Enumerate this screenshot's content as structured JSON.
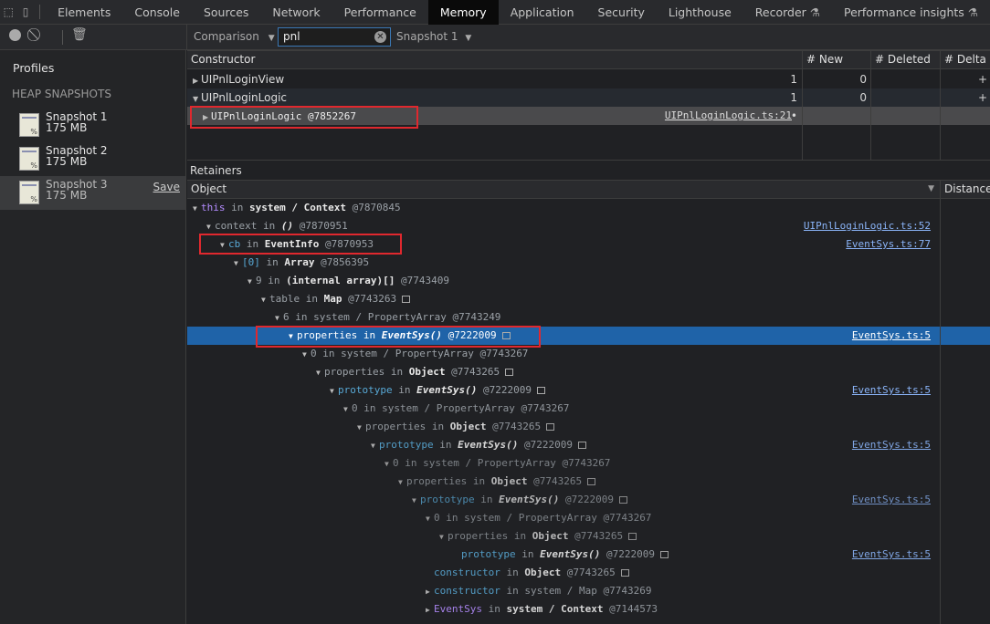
{
  "tabs": [
    {
      "label": "Elements"
    },
    {
      "label": "Console"
    },
    {
      "label": "Sources"
    },
    {
      "label": "Network"
    },
    {
      "label": "Performance"
    },
    {
      "label": "Memory",
      "active": true
    },
    {
      "label": "Application"
    },
    {
      "label": "Security"
    },
    {
      "label": "Lighthouse"
    },
    {
      "label": "Recorder",
      "experimental": true
    },
    {
      "label": "Performance insights",
      "experimental": true
    }
  ],
  "toolbar": {
    "view_select": "Comparison",
    "filter_value": "pnl",
    "baseline_select": "Snapshot 1"
  },
  "sidebar": {
    "title": "Profiles",
    "section": "HEAP SNAPSHOTS",
    "snapshots": [
      {
        "name": "Snapshot 1",
        "size": "175 MB"
      },
      {
        "name": "Snapshot 2",
        "size": "175 MB"
      },
      {
        "name": "Snapshot 3",
        "size": "175 MB",
        "selected": true,
        "save_label": "Save"
      }
    ]
  },
  "comparison": {
    "columns": [
      "Constructor",
      "# New",
      "# Deleted",
      "# Delta"
    ],
    "rows": [
      {
        "name": "UIPnlLoginView",
        "expanded": false,
        "new": "1",
        "deleted": "0",
        "delta": "+"
      },
      {
        "name": "UIPnlLoginLogic",
        "expanded": true,
        "new": "1",
        "deleted": "0",
        "delta": "+"
      },
      {
        "name": "UIPnlLoginLogic @7852267",
        "child": true,
        "link": "UIPnlLoginLogic.ts:21",
        "new": "•"
      }
    ]
  },
  "retainers": {
    "title": "Retainers",
    "columns": [
      "Object",
      "Distance"
    ],
    "rows": [
      {
        "d": 0,
        "a": "▼",
        "prop": "this",
        "pc": "pp",
        "cls": "system / Context",
        "ci": false,
        "id": "@7870845"
      },
      {
        "d": 1,
        "a": "▼",
        "prop": "context",
        "pc": "pn",
        "cls": "()",
        "ci": true,
        "id": "@7870951",
        "link": "UIPnlLoginLogic.ts:52"
      },
      {
        "d": 2,
        "a": "▼",
        "prop": "cb",
        "pc": "pc",
        "cls": "EventInfo",
        "id": "@7870953",
        "link": "EventSys.ts:77"
      },
      {
        "d": 3,
        "a": "▼",
        "prop": "[0]",
        "pc": "pc",
        "cls": "Array",
        "id": "@7856395"
      },
      {
        "d": 4,
        "a": "▼",
        "prop": "9",
        "pc": "pn",
        "cls": "(internal array)[]",
        "id": "@7743409"
      },
      {
        "d": 5,
        "a": "▼",
        "prop": "table",
        "pc": "pn",
        "cls": "Map",
        "id": "@7743263",
        "box": true
      },
      {
        "d": 6,
        "a": "▼",
        "prop": "6",
        "pc": "pn",
        "sys": "system / PropertyArray",
        "id": "@7743249"
      },
      {
        "d": 7,
        "a": "▼",
        "prop": "properties",
        "pc": "pn",
        "cls": "EventSys()",
        "ci": true,
        "id": "@7222009",
        "box": true,
        "link": "EventSys.ts:5",
        "selected": true
      },
      {
        "d": 8,
        "a": "▼",
        "prop": "0",
        "pc": "pn",
        "sys": "system / PropertyArray",
        "id": "@7743267"
      },
      {
        "d": 9,
        "a": "▼",
        "prop": "properties",
        "pc": "pn",
        "cls": "Object",
        "id": "@7743265",
        "box": true
      },
      {
        "d": 10,
        "a": "▼",
        "prop": "prototype",
        "pc": "pc",
        "cls": "EventSys()",
        "ci": true,
        "id": "@7222009",
        "box": true,
        "link": "EventSys.ts:5"
      },
      {
        "d": 11,
        "a": "▼",
        "prop": "0",
        "pc": "pn",
        "sys": "system / PropertyArray",
        "id": "@7743267"
      },
      {
        "d": 12,
        "a": "▼",
        "prop": "properties",
        "pc": "pn",
        "cls": "Object",
        "id": "@7743265",
        "box": true
      },
      {
        "d": 13,
        "a": "▼",
        "prop": "prototype",
        "pc": "pc",
        "cls": "EventSys()",
        "ci": true,
        "id": "@7222009",
        "box": true,
        "link": "EventSys.ts:5"
      },
      {
        "d": 14,
        "a": "▼",
        "prop": "0",
        "pc": "pn",
        "sys": "system / PropertyArray",
        "id": "@7743267"
      },
      {
        "d": 15,
        "a": "▼",
        "prop": "properties",
        "pc": "pn",
        "cls": "Object",
        "id": "@7743265",
        "box": true
      },
      {
        "d": 16,
        "a": "▼",
        "prop": "prototype",
        "pc": "pc",
        "cls": "EventSys()",
        "ci": true,
        "id": "@7222009",
        "box": true,
        "link": "EventSys.ts:5"
      },
      {
        "d": 17,
        "a": "▼",
        "prop": "0",
        "pc": "pn",
        "sys": "system / PropertyArray",
        "id": "@7743267"
      },
      {
        "d": 18,
        "a": "▼",
        "prop": "properties",
        "pc": "pn",
        "cls": "Object",
        "id": "@7743265",
        "box": true
      },
      {
        "d": 19,
        "a": "",
        "prop": "prototype",
        "pc": "pc",
        "cls": "EventSys()",
        "ci": true,
        "id": "@7222009",
        "box": true,
        "link": "EventSys.ts:5"
      },
      {
        "d": 17,
        "a": "",
        "prop": "constructor",
        "pc": "pc",
        "cls": "Object",
        "id": "@7743265",
        "box": true
      },
      {
        "d": 17,
        "a": "▶",
        "prop": "constructor",
        "pc": "pc",
        "sys": "system / Map",
        "id": "@7743269"
      },
      {
        "d": 17,
        "a": "▶",
        "prop": "EventSys",
        "pc": "pp",
        "cls": "system / Context",
        "id": "@7144573"
      }
    ]
  },
  "colors": {
    "selection": "#1f63a8",
    "highlight_box": "#e0282e",
    "link": "#8ab4f8"
  }
}
